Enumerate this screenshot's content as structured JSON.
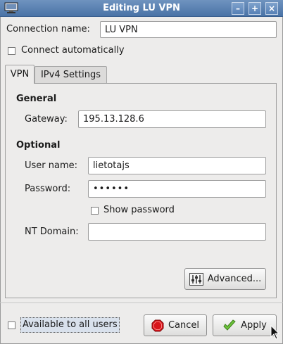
{
  "window": {
    "title": "Editing LU VPN",
    "controls": [
      "–",
      "+",
      "×"
    ]
  },
  "connection": {
    "name_label": "Connection name:",
    "name_value": "LU VPN",
    "connect_auto_label": "Connect automatically",
    "connect_auto_checked": false
  },
  "tabs": [
    {
      "label": "VPN",
      "active": true
    },
    {
      "label": "IPv4 Settings",
      "active": false
    }
  ],
  "vpn": {
    "general_heading": "General",
    "gateway_label": "Gateway:",
    "gateway_value": "195.13.128.6",
    "optional_heading": "Optional",
    "username_label": "User name:",
    "username_value": "lietotajs",
    "password_label": "Password:",
    "password_value": "••••••",
    "show_password_label": "Show password",
    "show_password_checked": false,
    "ntdomain_label": "NT Domain:",
    "ntdomain_value": "",
    "advanced_label": "Advanced..."
  },
  "footer": {
    "available_all_label": "Available to all users",
    "available_all_checked": false,
    "cancel_label": "Cancel",
    "apply_label": "Apply"
  },
  "icons": {
    "app": "network-connection-icon",
    "advanced": "settings-icon",
    "cancel": "stop-icon",
    "apply": "check-icon"
  }
}
